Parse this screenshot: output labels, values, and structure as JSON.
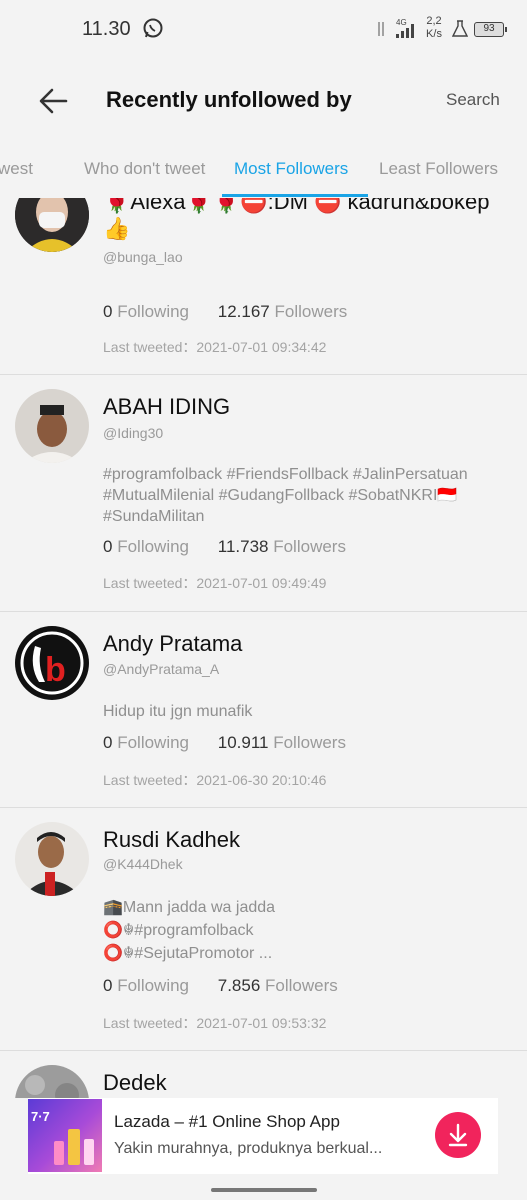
{
  "status_bar": {
    "time": "11.30",
    "network": "4G",
    "speed_value": "2,2",
    "speed_unit": "K/s",
    "battery": "93"
  },
  "header": {
    "title": "Recently unfollowed by",
    "search_label": "Search"
  },
  "tabs": [
    {
      "label": "west"
    },
    {
      "label": "Who don't tweet"
    },
    {
      "label": "Most Followers",
      "active": true
    },
    {
      "label": "Least Followers"
    }
  ],
  "users": [
    {
      "name": "🌹Alexa🌹🌹⛔:DM ⛔ kadrun&bokep👍",
      "handle": "@bunga_lao",
      "bio": "",
      "following": "0",
      "following_label": "Following",
      "followers": "12.167",
      "followers_label": "Followers",
      "last_tweeted_label": "Last tweeted：",
      "last_tweeted": "2021-07-01 09:34:42"
    },
    {
      "name": "ABAH IDING",
      "handle": "@Iding30",
      "bio": "#programfolback #FriendsFollback #JalinPersatuan #MutualMilenial #GudangFollback #SobatNKRI🇮🇩 #SundaMilitan",
      "following": "0",
      "following_label": "Following",
      "followers": "11.738",
      "followers_label": "Followers",
      "last_tweeted_label": "Last tweeted：",
      "last_tweeted": "2021-07-01 09:49:49"
    },
    {
      "name": "Andy Pratama",
      "handle": "@AndyPratama_A",
      "bio": "Hidup itu jgn munafik",
      "following": "0",
      "following_label": "Following",
      "followers": "10.911",
      "followers_label": "Followers",
      "last_tweeted_label": "Last tweeted：",
      "last_tweeted": "2021-06-30 20:10:46"
    },
    {
      "name": "Rusdi Kadhek",
      "handle": "@K444Dhek",
      "bio": "🕋Mann jadda wa jadda\n⭕☬#programfolback\n⭕☬#SejutaPromotor ...",
      "following": "0",
      "following_label": "Following",
      "followers": "7.856",
      "followers_label": "Followers",
      "last_tweeted_label": "Last tweeted：",
      "last_tweeted": "2021-07-01 09:53:32"
    },
    {
      "name": "Dedek"
    }
  ],
  "ad": {
    "thumb_text": "7·7",
    "title": "Lazada – #1 Online Shop App",
    "subtitle": "Yakin murahnya, produknya berkual..."
  },
  "colors": {
    "accent": "#1aa4e6",
    "background": "#f3f3f3",
    "ad_download": "#f1245c"
  }
}
